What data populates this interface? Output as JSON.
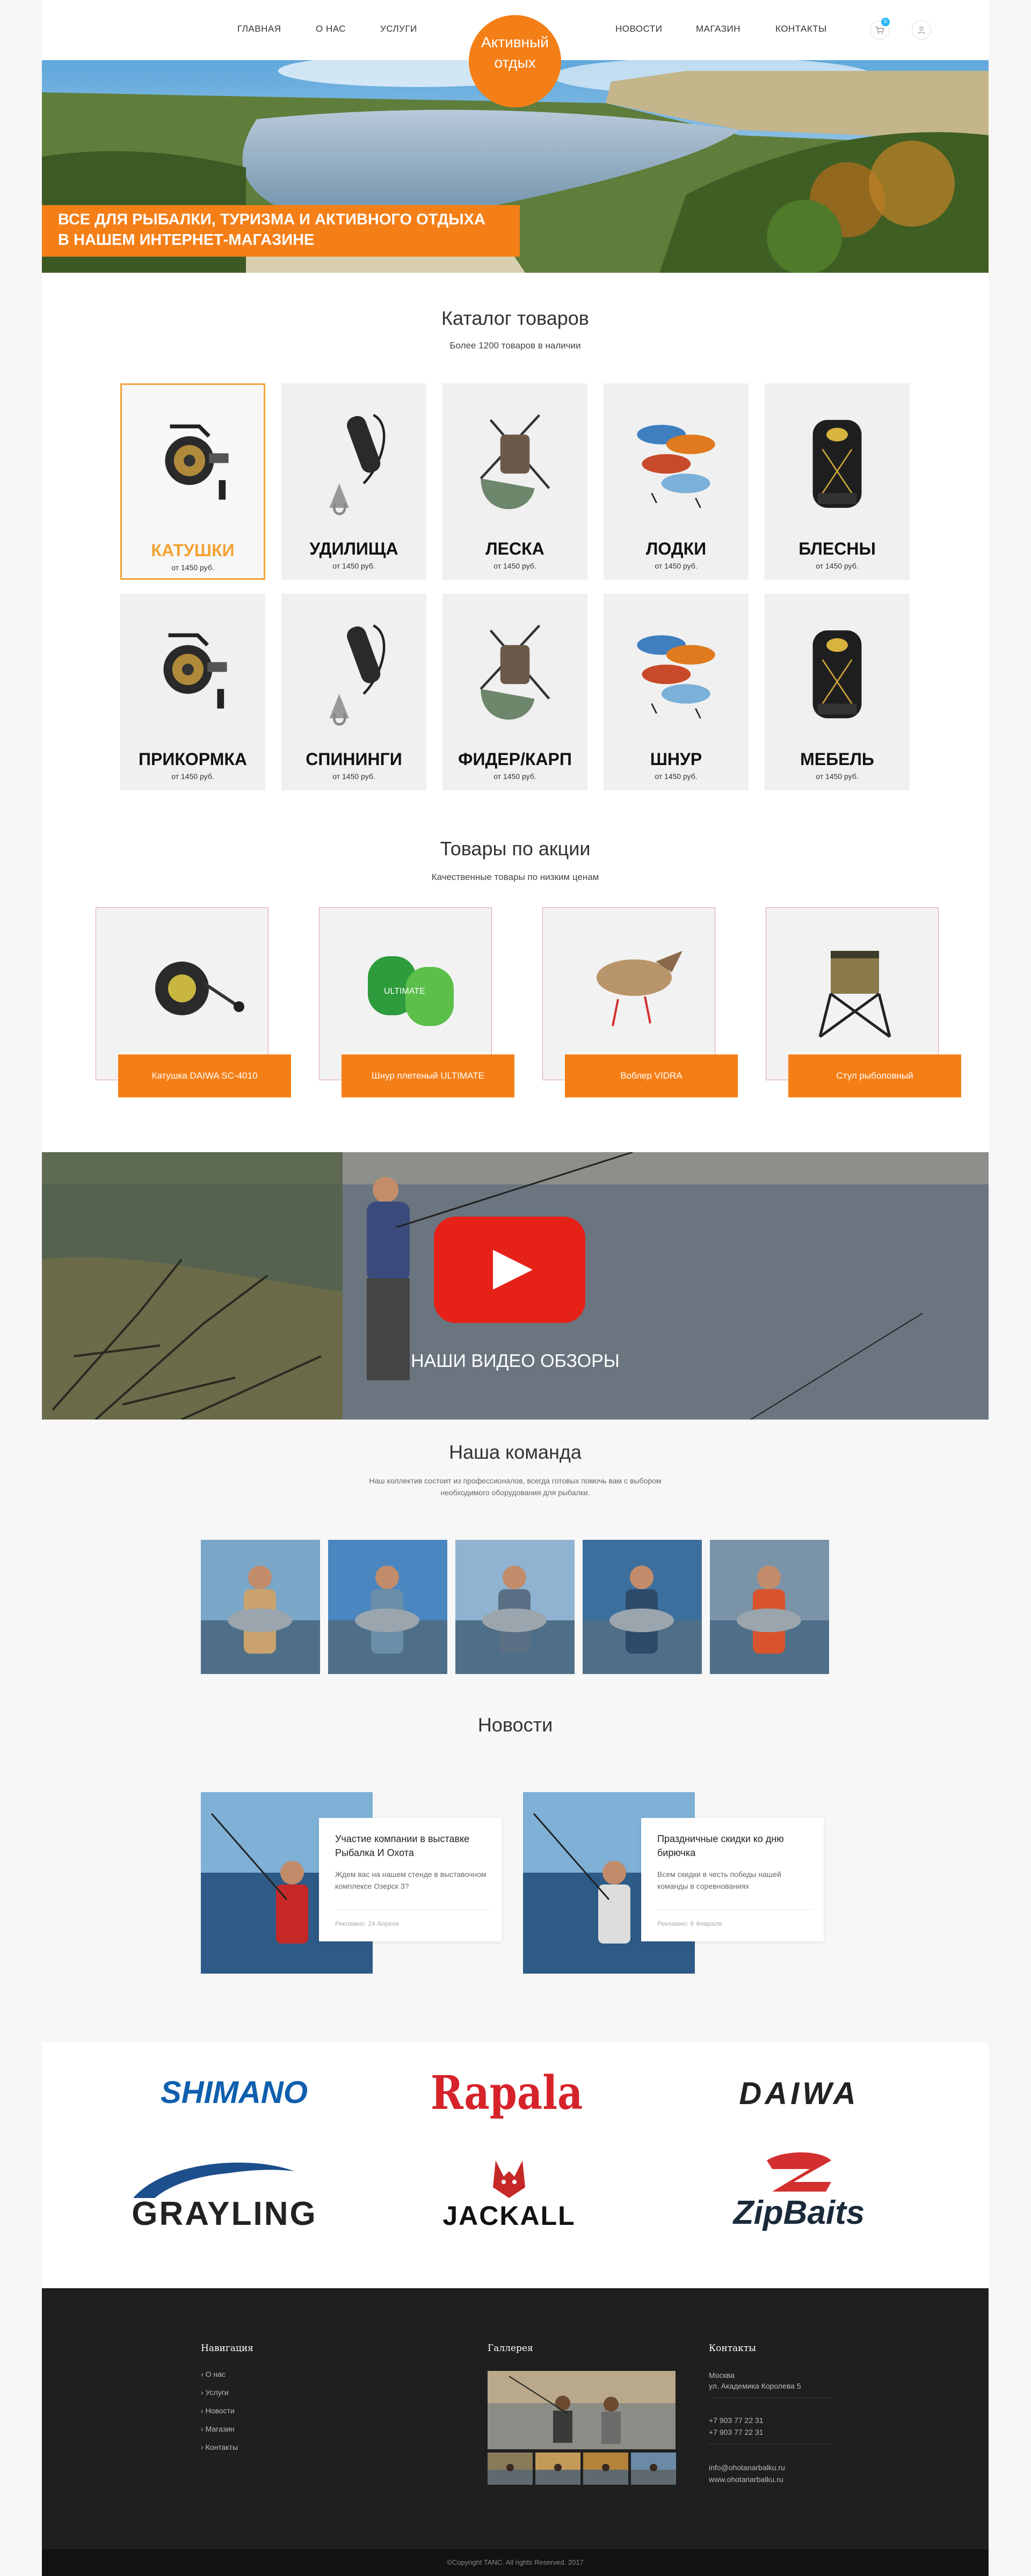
{
  "header": {
    "nav_left": [
      "ГЛАВНАЯ",
      "О НАС",
      "УСЛУГИ"
    ],
    "nav_right": [
      "НОВОСТИ",
      "МАГАЗИН",
      "КОНТАКТЫ"
    ],
    "logo_line1": "Активный",
    "logo_line2": "отдых",
    "cart_count": "0"
  },
  "hero": {
    "line1": "ВСЕ ДЛЯ РЫБАЛКИ, ТУРИЗМА И АКТИВНОГО ОТДЫХА",
    "line2": "В НАШЕМ ИНТЕРНЕТ-МАГАЗИНЕ"
  },
  "catalog": {
    "title": "Каталог товаров",
    "subtitle": "Более 1200 товаров в наличии",
    "items": [
      {
        "name": "КАТУШКИ",
        "price": "от 1450 руб.",
        "icon": "reel-icon"
      },
      {
        "name": "УДИЛИЩА",
        "price": "от 1450 руб.",
        "icon": "grip-icon"
      },
      {
        "name": "ЛЕСКА",
        "price": "от 1450 руб.",
        "icon": "net-icon"
      },
      {
        "name": "ЛОДКИ",
        "price": "от 1450 руб.",
        "icon": "lure-icon"
      },
      {
        "name": "БЛЕСНЫ",
        "price": "от 1450 руб.",
        "icon": "backpack-icon"
      },
      {
        "name": "ПРИКОРМКА",
        "price": "от 1450 руб.",
        "icon": "reel-icon"
      },
      {
        "name": "СПИНИНГИ",
        "price": "от 1450 руб.",
        "icon": "grip-icon"
      },
      {
        "name": "ФИДЕР/КАРП",
        "price": "от 1450 руб.",
        "icon": "net-icon"
      },
      {
        "name": "ШНУР",
        "price": "от 1450 руб.",
        "icon": "lure-icon"
      },
      {
        "name": "МЕБЕЛЬ",
        "price": "от 1450 руб.",
        "icon": "backpack-icon"
      }
    ]
  },
  "promo": {
    "title": "Товары по акции",
    "subtitle": "Качественные товары по низким ценам",
    "items": [
      "Катушка DAIWA SC-4010",
      "Шнур плетеный ULTIMATE",
      "Воблер VIDRA",
      "Стул рыболовный"
    ]
  },
  "video": {
    "caption": "НАШИ ВИДЕО ОБЗОРЫ"
  },
  "team": {
    "title": "Наша команда",
    "text1": "Наш коллектив состоит из профессионалов, всегда готовых помочь вам с выбором",
    "text2": "необходимого оборудования для рыбалки."
  },
  "news": {
    "title": "Новости",
    "items": [
      {
        "title": "Участие компании в выставке Рыбалка И Охота",
        "text": "Ждем вас на нашем стенде в выставочном комплексе Озерск 3?",
        "meta": "Рекламно: 24 Апреля"
      },
      {
        "title": "Праздничные скидки ко дню бирючка",
        "text": "Всем скидки в честь победы нашей команды в соревнованиях",
        "meta": "Рекламно: 9 Февраля"
      }
    ]
  },
  "brands": [
    "SHIMANO",
    "Rapala",
    "DAIWA",
    "GRAYLING",
    "JACKALL",
    "ZipBaits"
  ],
  "footer": {
    "nav_title": "Навигация",
    "nav_items": [
      "О нас",
      "Услуги",
      "Новости",
      "Магазин",
      "Контакты"
    ],
    "gallery_title": "Галлерея",
    "contacts_title": "Контакты",
    "city": "Москва",
    "address": "ул. Академика Королева 5",
    "phone1": "+7 903 77 22 31",
    "phone2": "+7 903 77 22 31",
    "email": "info@ohotanarbalku.ru",
    "site": "www.ohotanarbalku.ru",
    "copyright": "©Copyright TANC. All rights Reserved. 2017"
  },
  "colors": {
    "accent": "#f57f17",
    "footer": "#1f1f1f",
    "youtube": "#e62117"
  }
}
